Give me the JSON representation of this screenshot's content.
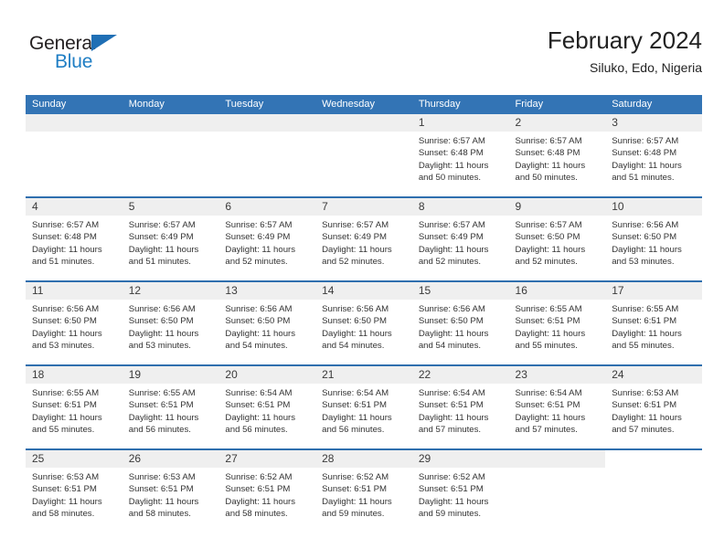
{
  "logo": {
    "word_dark": "General",
    "word_blue": "Blue",
    "triangle_color": "#1f6fb5",
    "blue_color": "#1f7ec4"
  },
  "header": {
    "title": "February 2024",
    "subtitle": "Siluko, Edo, Nigeria"
  },
  "colors": {
    "header_blue": "#3374b5",
    "row_divider_blue": "#2f6fae",
    "daynum_band": "#efefef",
    "text": "#333333"
  },
  "weekdays": [
    "Sunday",
    "Monday",
    "Tuesday",
    "Wednesday",
    "Thursday",
    "Friday",
    "Saturday"
  ],
  "weeks": [
    [
      {
        "day": "",
        "lines": []
      },
      {
        "day": "",
        "lines": []
      },
      {
        "day": "",
        "lines": []
      },
      {
        "day": "",
        "lines": []
      },
      {
        "day": "1",
        "lines": [
          "Sunrise: 6:57 AM",
          "Sunset: 6:48 PM",
          "Daylight: 11 hours",
          "and 50 minutes."
        ]
      },
      {
        "day": "2",
        "lines": [
          "Sunrise: 6:57 AM",
          "Sunset: 6:48 PM",
          "Daylight: 11 hours",
          "and 50 minutes."
        ]
      },
      {
        "day": "3",
        "lines": [
          "Sunrise: 6:57 AM",
          "Sunset: 6:48 PM",
          "Daylight: 11 hours",
          "and 51 minutes."
        ]
      }
    ],
    [
      {
        "day": "4",
        "lines": [
          "Sunrise: 6:57 AM",
          "Sunset: 6:48 PM",
          "Daylight: 11 hours",
          "and 51 minutes."
        ]
      },
      {
        "day": "5",
        "lines": [
          "Sunrise: 6:57 AM",
          "Sunset: 6:49 PM",
          "Daylight: 11 hours",
          "and 51 minutes."
        ]
      },
      {
        "day": "6",
        "lines": [
          "Sunrise: 6:57 AM",
          "Sunset: 6:49 PM",
          "Daylight: 11 hours",
          "and 52 minutes."
        ]
      },
      {
        "day": "7",
        "lines": [
          "Sunrise: 6:57 AM",
          "Sunset: 6:49 PM",
          "Daylight: 11 hours",
          "and 52 minutes."
        ]
      },
      {
        "day": "8",
        "lines": [
          "Sunrise: 6:57 AM",
          "Sunset: 6:49 PM",
          "Daylight: 11 hours",
          "and 52 minutes."
        ]
      },
      {
        "day": "9",
        "lines": [
          "Sunrise: 6:57 AM",
          "Sunset: 6:50 PM",
          "Daylight: 11 hours",
          "and 52 minutes."
        ]
      },
      {
        "day": "10",
        "lines": [
          "Sunrise: 6:56 AM",
          "Sunset: 6:50 PM",
          "Daylight: 11 hours",
          "and 53 minutes."
        ]
      }
    ],
    [
      {
        "day": "11",
        "lines": [
          "Sunrise: 6:56 AM",
          "Sunset: 6:50 PM",
          "Daylight: 11 hours",
          "and 53 minutes."
        ]
      },
      {
        "day": "12",
        "lines": [
          "Sunrise: 6:56 AM",
          "Sunset: 6:50 PM",
          "Daylight: 11 hours",
          "and 53 minutes."
        ]
      },
      {
        "day": "13",
        "lines": [
          "Sunrise: 6:56 AM",
          "Sunset: 6:50 PM",
          "Daylight: 11 hours",
          "and 54 minutes."
        ]
      },
      {
        "day": "14",
        "lines": [
          "Sunrise: 6:56 AM",
          "Sunset: 6:50 PM",
          "Daylight: 11 hours",
          "and 54 minutes."
        ]
      },
      {
        "day": "15",
        "lines": [
          "Sunrise: 6:56 AM",
          "Sunset: 6:50 PM",
          "Daylight: 11 hours",
          "and 54 minutes."
        ]
      },
      {
        "day": "16",
        "lines": [
          "Sunrise: 6:55 AM",
          "Sunset: 6:51 PM",
          "Daylight: 11 hours",
          "and 55 minutes."
        ]
      },
      {
        "day": "17",
        "lines": [
          "Sunrise: 6:55 AM",
          "Sunset: 6:51 PM",
          "Daylight: 11 hours",
          "and 55 minutes."
        ]
      }
    ],
    [
      {
        "day": "18",
        "lines": [
          "Sunrise: 6:55 AM",
          "Sunset: 6:51 PM",
          "Daylight: 11 hours",
          "and 55 minutes."
        ]
      },
      {
        "day": "19",
        "lines": [
          "Sunrise: 6:55 AM",
          "Sunset: 6:51 PM",
          "Daylight: 11 hours",
          "and 56 minutes."
        ]
      },
      {
        "day": "20",
        "lines": [
          "Sunrise: 6:54 AM",
          "Sunset: 6:51 PM",
          "Daylight: 11 hours",
          "and 56 minutes."
        ]
      },
      {
        "day": "21",
        "lines": [
          "Sunrise: 6:54 AM",
          "Sunset: 6:51 PM",
          "Daylight: 11 hours",
          "and 56 minutes."
        ]
      },
      {
        "day": "22",
        "lines": [
          "Sunrise: 6:54 AM",
          "Sunset: 6:51 PM",
          "Daylight: 11 hours",
          "and 57 minutes."
        ]
      },
      {
        "day": "23",
        "lines": [
          "Sunrise: 6:54 AM",
          "Sunset: 6:51 PM",
          "Daylight: 11 hours",
          "and 57 minutes."
        ]
      },
      {
        "day": "24",
        "lines": [
          "Sunrise: 6:53 AM",
          "Sunset: 6:51 PM",
          "Daylight: 11 hours",
          "and 57 minutes."
        ]
      }
    ],
    [
      {
        "day": "25",
        "lines": [
          "Sunrise: 6:53 AM",
          "Sunset: 6:51 PM",
          "Daylight: 11 hours",
          "and 58 minutes."
        ]
      },
      {
        "day": "26",
        "lines": [
          "Sunrise: 6:53 AM",
          "Sunset: 6:51 PM",
          "Daylight: 11 hours",
          "and 58 minutes."
        ]
      },
      {
        "day": "27",
        "lines": [
          "Sunrise: 6:52 AM",
          "Sunset: 6:51 PM",
          "Daylight: 11 hours",
          "and 58 minutes."
        ]
      },
      {
        "day": "28",
        "lines": [
          "Sunrise: 6:52 AM",
          "Sunset: 6:51 PM",
          "Daylight: 11 hours",
          "and 59 minutes."
        ]
      },
      {
        "day": "29",
        "lines": [
          "Sunrise: 6:52 AM",
          "Sunset: 6:51 PM",
          "Daylight: 11 hours",
          "and 59 minutes."
        ]
      },
      {
        "day": "",
        "lines": []
      },
      {
        "day": "",
        "lines": []
      }
    ]
  ]
}
